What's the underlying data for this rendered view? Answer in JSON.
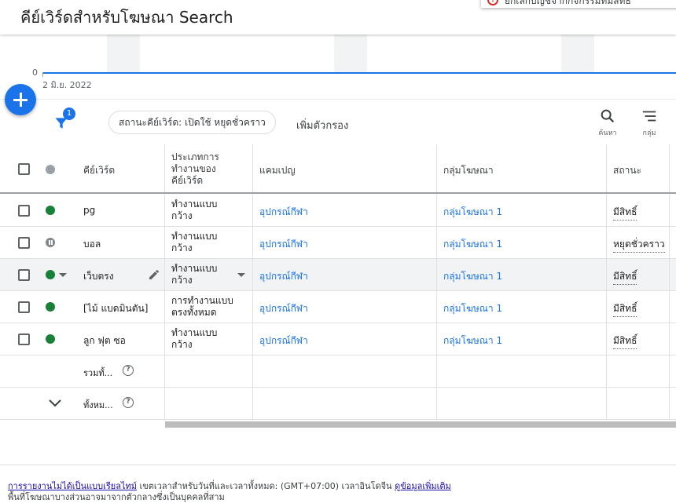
{
  "header": {
    "title": "คีย์เวิร์ดสำหรับโฆษณา Search",
    "toast_text": "ยกเลิกบัญชีจากกิจกรรมที่มีสิทธิ์"
  },
  "chart": {
    "zero_label": "0",
    "date_label": "2 มิ.ย. 2022",
    "line_color": "#1a73e8"
  },
  "fab": {
    "icon": "add-icon"
  },
  "toolbar": {
    "filter_count": "1",
    "status_chip": "สถานะคีย์เวิร์ด: เปิดใช้ หยุดชั่วคราว",
    "add_filter": "เพิ่มตัวกรอง",
    "search_label": "ค้นหา",
    "group_label": "กลุ่ม"
  },
  "table": {
    "columns": {
      "keyword": "คีย์เวิร์ด",
      "match_type": "ประเภทการทำงานของคีย์เวิร์ด",
      "campaign": "แคมเปญ",
      "ad_group": "กลุ่มโฆษณา",
      "status": "สถานะ"
    },
    "rows": [
      {
        "status_dot": "green",
        "keyword": "pg",
        "match_type": "ทำงานแบบกว้าง",
        "campaign": "อุปกรณ์กีฬา",
        "ad_group": "กลุ่มโฆษณา 1",
        "status": "มีสิทธิ์"
      },
      {
        "status_dot": "paused",
        "keyword": "บอล",
        "match_type": "ทำงานแบบกว้าง",
        "campaign": "อุปกรณ์กีฬา",
        "ad_group": "กลุ่มโฆษณา 1",
        "status": "หยุดชั่วคราว"
      },
      {
        "status_dot": "green",
        "keyword": "เว็บตรง",
        "match_type": "ทำงานแบบกว้าง",
        "campaign": "อุปกรณ์กีฬา",
        "ad_group": "กลุ่มโฆษณา 1",
        "status": "มีสิทธิ์"
      },
      {
        "status_dot": "green",
        "keyword": "[ไม้ แบดมินตัน]",
        "match_type": "การทำงานแบบตรงทั้งหมด",
        "campaign": "อุปกรณ์กีฬา",
        "ad_group": "กลุ่มโฆษณา 1",
        "status": "มีสิทธิ์"
      },
      {
        "status_dot": "green",
        "keyword": "ลูก ฟุต ซอ",
        "match_type": "ทำงานแบบกว้าง",
        "campaign": "อุปกรณ์กีฬา",
        "ad_group": "กลุ่มโฆษณา 1",
        "status": "มีสิทธิ์"
      }
    ],
    "summary_total_label": "รวมทั้...",
    "summary_all_label": "ทั้งหม..."
  },
  "footer": {
    "link1": "การรายงานไม่ได้เป็นแบบเรียลไทม์",
    "text1": " เขตเวลาสำหรับวันที่และเวลาทั้งหมด: (GMT+07:00) เวลาอินโดจีน ",
    "link2": "ดูข้อมูลเพิ่มเติม",
    "line2": "พื้นที่โฆษณาบางส่วนอาจมาจากตัวกลางซึ่งเป็นบุคคลที่สาม"
  }
}
